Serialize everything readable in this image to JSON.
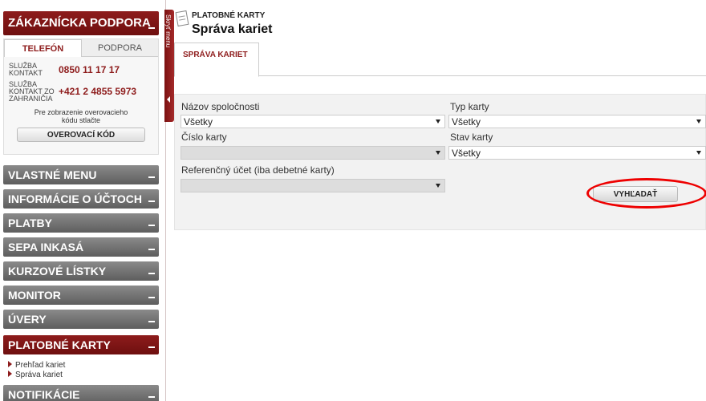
{
  "sidebar": {
    "support_title": "ZÁKAZNÍCKA PODPORA",
    "tabs": [
      "TELEFÓN",
      "PODPORA"
    ],
    "contacts": [
      {
        "label": "SLUŽBA KONTAKT",
        "value": "0850 11 17 17"
      },
      {
        "label": "SLUŽBA KONTAKT ZO ZAHRANIČIA",
        "value": "+421 2 4855 5973"
      }
    ],
    "verify_text": "Pre zobrazenie overovacieho kódu stlačte",
    "verify_button": "OVEROVACÍ KÓD",
    "nav": [
      "VLASTNÉ MENU",
      "INFORMÁCIE O ÚČTOCH",
      "PLATBY",
      "SEPA INKASÁ",
      "KURZOVÉ LÍSTKY",
      "MONITOR",
      "ÚVERY",
      "PLATOBNÉ KARTY",
      "NOTIFIKÁCIE"
    ],
    "sub_items": [
      "Prehľad kariet",
      "Správa kariet"
    ]
  },
  "hide_menu": "Skryť menu",
  "main": {
    "breadcrumb": "PLATOBNÉ KARTY",
    "title": "Správa kariet",
    "tab": "SPRÁVA KARIET",
    "form": {
      "company_label": "Názov spoločnosti",
      "company_value": "Všetky",
      "card_type_label": "Typ karty",
      "card_type_value": "Všetky",
      "card_number_label": "Číslo karty",
      "card_state_label": "Stav karty",
      "card_state_value": "Všetky",
      "ref_account_label": "Referenčný účet (iba debetné karty)",
      "search_button": "VYHĽADAŤ"
    }
  },
  "colors": {
    "brand": "#8e1c1c",
    "nav_gray": "#6e6e6e",
    "highlight": "#e00000"
  }
}
